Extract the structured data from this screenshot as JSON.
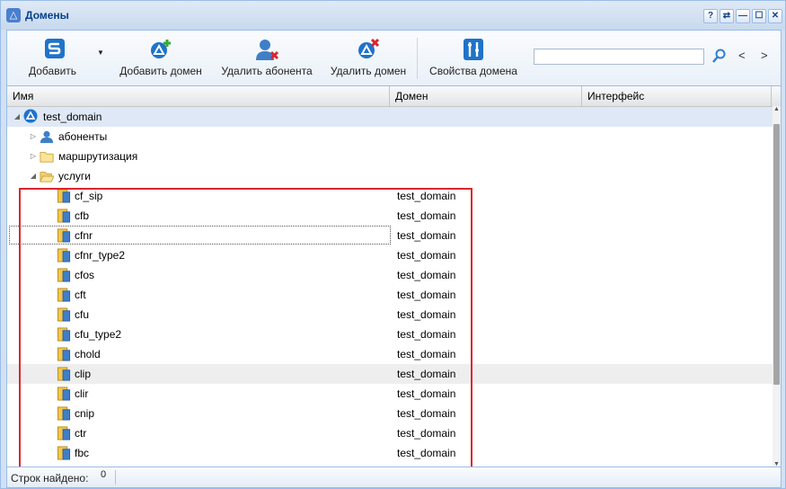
{
  "window": {
    "title": "Домены"
  },
  "title_tools": [
    "?",
    "⇄",
    "—",
    "☐",
    "✕"
  ],
  "toolbar": {
    "add_label": "Добавить",
    "add_domain_label": "Добавить домен",
    "delete_subscriber_label": "Удалить абонента",
    "delete_domain_label": "Удалить домен",
    "domain_properties_label": "Свойства домена",
    "search_value": "",
    "prev_label": "<",
    "next_label": ">"
  },
  "grid": {
    "columns": [
      "Имя",
      "Домен",
      "Интерфейс"
    ],
    "root": {
      "name": "test_domain",
      "expander": "◢"
    },
    "folders": [
      {
        "name": "абоненты",
        "expander": "▷"
      },
      {
        "name": "маршрутизация",
        "expander": "▷"
      },
      {
        "name": "услуги",
        "expander": "◢"
      }
    ],
    "services": [
      {
        "name": "cf_sip",
        "domain": "test_domain"
      },
      {
        "name": "cfb",
        "domain": "test_domain"
      },
      {
        "name": "cfnr",
        "domain": "test_domain"
      },
      {
        "name": "cfnr_type2",
        "domain": "test_domain"
      },
      {
        "name": "cfos",
        "domain": "test_domain"
      },
      {
        "name": "cft",
        "domain": "test_domain"
      },
      {
        "name": "cfu",
        "domain": "test_domain"
      },
      {
        "name": "cfu_type2",
        "domain": "test_domain"
      },
      {
        "name": "chold",
        "domain": "test_domain"
      },
      {
        "name": "clip",
        "domain": "test_domain"
      },
      {
        "name": "clir",
        "domain": "test_domain"
      },
      {
        "name": "cnip",
        "domain": "test_domain"
      },
      {
        "name": "ctr",
        "domain": "test_domain"
      },
      {
        "name": "fbc",
        "domain": "test_domain"
      }
    ]
  },
  "status": {
    "label": "Строк найдено:",
    "count": "0"
  },
  "colors": {
    "accent": "#99bce8",
    "highlight": "#d9262e",
    "title_text": "#04408c"
  }
}
